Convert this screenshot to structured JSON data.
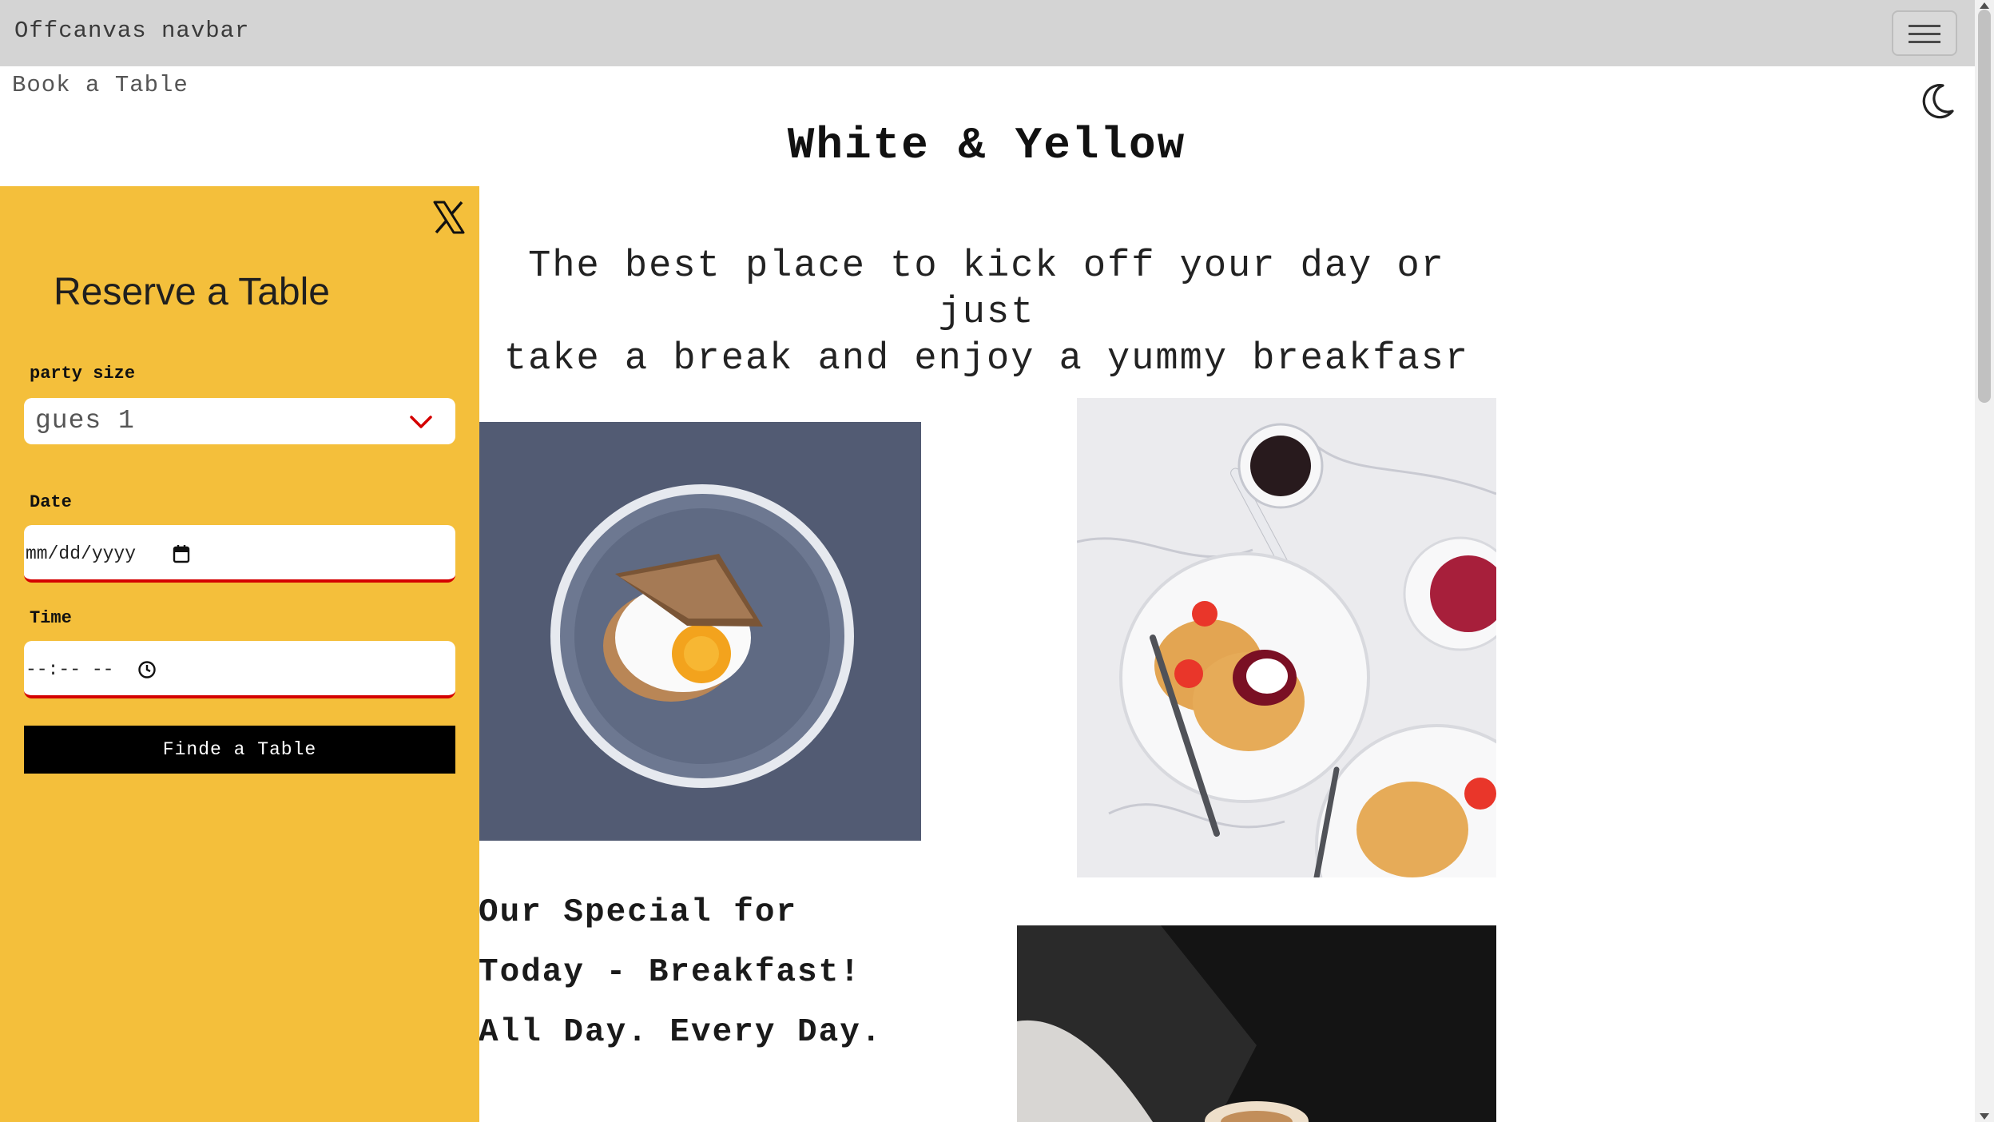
{
  "navbar": {
    "brand": "Offcanvas navbar",
    "toggler_icon": "hamburger-menu-icon"
  },
  "book_link": "Book a Table",
  "theme_icon": "moon-icon",
  "hero": {
    "title": "White & Yellow",
    "tagline_line1": "The best place to kick off your day or just",
    "tagline_line2": "take a break and enjoy a yummy breakfasr"
  },
  "special": {
    "line1": "Our Special for",
    "line2": "Today - Breakfast!",
    "line3": "All Day. Every Day."
  },
  "images": {
    "egg": "egg-toast-plate-photo",
    "pancakes": "pancakes-strawberries-photo",
    "coffee": "coffee-cup-photo"
  },
  "offcanvas": {
    "close_icon": "x-close-icon",
    "title": "Reserve a Table",
    "party_label": "party size",
    "party_value": "gues 1",
    "date_label": "Date",
    "date_placeholder": "mm/dd/yyyy",
    "time_label": "Time",
    "time_placeholder": "--:-- --",
    "submit_label": "Finde a Table"
  },
  "colors": {
    "offcanvas_bg": "#f4bf3b",
    "navbar_bg": "#d4d4d4",
    "accent_red": "#d40000",
    "button_bg": "#000000"
  }
}
